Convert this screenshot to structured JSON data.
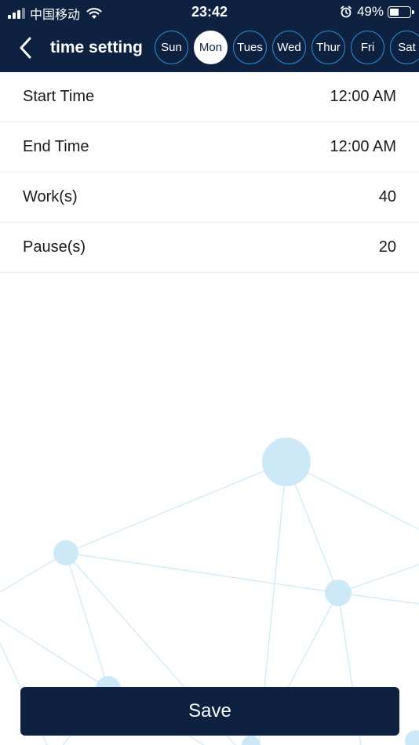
{
  "status_bar": {
    "carrier": "中国移动",
    "time": "23:42",
    "battery_percent": "49%",
    "battery_level": 0.49
  },
  "nav": {
    "title": "time setting",
    "back_icon": "chevron-left-icon",
    "days": [
      {
        "label": "Sun",
        "selected": false
      },
      {
        "label": "Mon",
        "selected": true
      },
      {
        "label": "Tues",
        "selected": false
      },
      {
        "label": "Wed",
        "selected": false
      },
      {
        "label": "Thur",
        "selected": false
      },
      {
        "label": "Fri",
        "selected": false
      },
      {
        "label": "Sat",
        "selected": false
      }
    ]
  },
  "settings": [
    {
      "label": "Start Time",
      "value": "12:00 AM"
    },
    {
      "label": "End Time",
      "value": "12:00 AM"
    },
    {
      "label": "Work(s)",
      "value": "40"
    },
    {
      "label": "Pause(s)",
      "value": "20"
    }
  ],
  "save_label": "Save",
  "colors": {
    "primary": "#0e2140",
    "day_border": "#2f8fd6",
    "network": "#cde9f8"
  }
}
